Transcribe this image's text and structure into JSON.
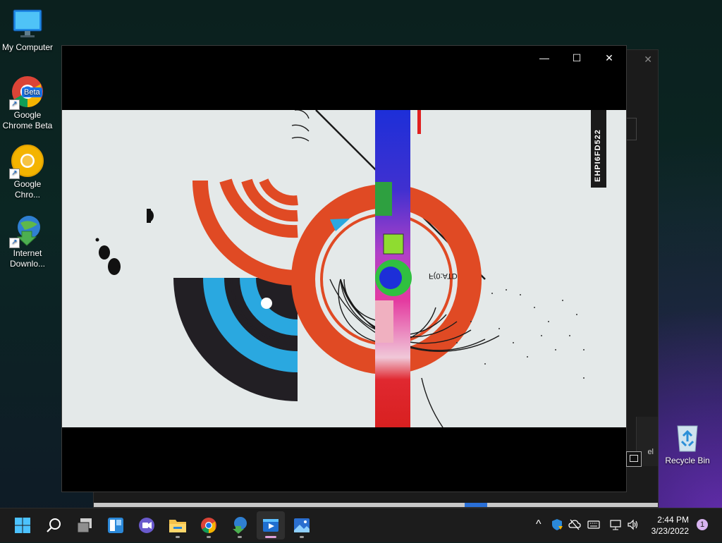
{
  "desktop": {
    "icons": [
      {
        "label": "My Computer"
      },
      {
        "label": "Google Chrome Beta",
        "badge": "Beta"
      },
      {
        "label": "Google Chro..."
      },
      {
        "label": "Internet Downlo..."
      },
      {
        "label": "Recycle Bin"
      }
    ]
  },
  "background_window": {
    "close_glyph": "✕",
    "panel_glyph": "el"
  },
  "player": {
    "minimize_glyph": "—",
    "maximize_glyph": "☐",
    "close_glyph": "✕",
    "video": {
      "vertical_text": "EHPI6FD522",
      "mirrored_text": "F(0:ATD"
    }
  },
  "taskbar": {
    "items": [
      {
        "name": "start",
        "icon": "windows-logo-icon"
      },
      {
        "name": "search",
        "icon": "search-icon"
      },
      {
        "name": "task-view",
        "icon": "task-view-icon"
      },
      {
        "name": "widgets",
        "icon": "widgets-icon"
      },
      {
        "name": "chat",
        "icon": "teams-chat-icon"
      },
      {
        "name": "file-explorer",
        "icon": "folder-icon"
      },
      {
        "name": "chrome",
        "icon": "chrome-icon"
      },
      {
        "name": "internet-download-manager",
        "icon": "idm-icon"
      },
      {
        "name": "media-player",
        "icon": "media-player-icon"
      },
      {
        "name": "photos",
        "icon": "photos-icon"
      }
    ],
    "tray": {
      "overflow_glyph": "^",
      "time": "2:44 PM",
      "date": "3/23/2022",
      "notification_count": "1"
    }
  },
  "colors": {
    "accent": "#2a6fd6",
    "chrome_red": "#db4437",
    "chrome_yellow": "#f4b400",
    "chrome_green": "#0f9d58"
  }
}
